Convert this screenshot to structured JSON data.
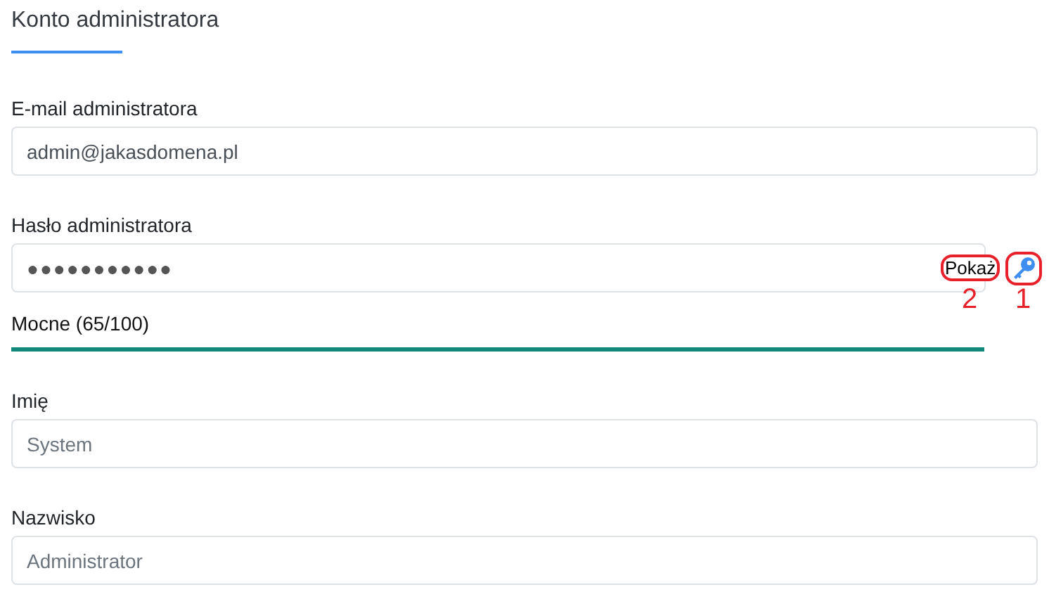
{
  "section": {
    "title": "Konto administratora"
  },
  "fields": [
    {
      "kind": "text",
      "label": "E-mail administratora",
      "value": "admin@jakasdomena.pl"
    },
    {
      "kind": "password",
      "label": "Hasło administratora",
      "value": "●●●●●●●●●●●",
      "show_label": "Pokaż",
      "show_callout": "2",
      "key_callout": "1",
      "strength": {
        "text": "Mocne (65/100)",
        "level": 1
      }
    },
    {
      "kind": "text",
      "label": "Imię",
      "placeholder": "System"
    },
    {
      "kind": "text",
      "label": "Nazwisko",
      "placeholder": "Administrator"
    }
  ]
}
